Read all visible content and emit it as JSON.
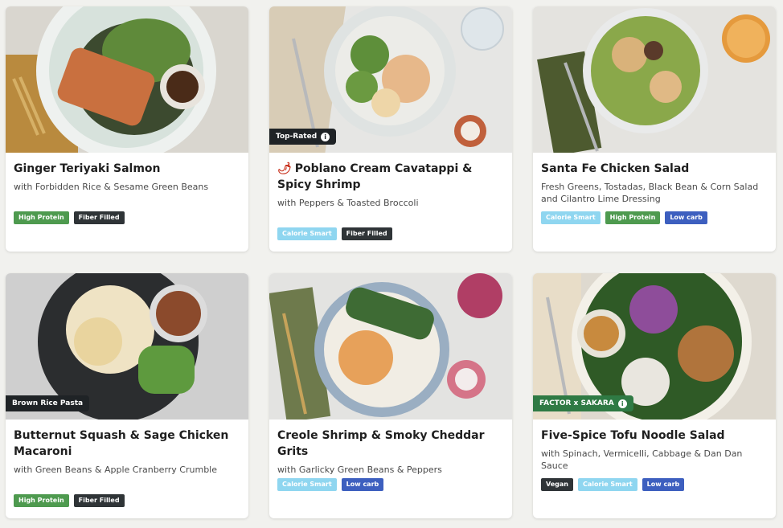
{
  "cards": [
    {
      "title": "Ginger Teriyaki Salmon",
      "subtitle": "with Forbidden Rice & Sesame Green Beans",
      "tags": [
        "High Protein",
        "Fiber Filled"
      ]
    },
    {
      "title": "Poblano Cream Cavatappi & Spicy Shrimp",
      "subtitle": "with Peppers & Toasted Broccoli",
      "badge": "Top-Rated",
      "spicy_icon": "chili-icon",
      "tags": [
        "Calorie Smart",
        "Fiber Filled"
      ]
    },
    {
      "title": "Santa Fe Chicken Salad",
      "subtitle": "Fresh Greens, Tostadas, Black Bean & Corn Salad and Cilantro Lime Dressing",
      "tags": [
        "Calorie Smart",
        "High Protein",
        "Low carb"
      ]
    },
    {
      "title": "Butternut Squash & Sage Chicken Macaroni",
      "subtitle": "with Green Beans & Apple Cranberry Crumble",
      "badge": "Brown Rice Pasta",
      "tags": [
        "High Protein",
        "Fiber Filled"
      ]
    },
    {
      "title": "Creole Shrimp & Smoky Cheddar Grits",
      "subtitle": "with Garlicky Green Beans & Peppers",
      "tags": [
        "Calorie Smart",
        "Low carb"
      ]
    },
    {
      "title": "Five-Spice Tofu Noodle Salad",
      "subtitle": "with Spinach, Vermicelli, Cabbage & Dan Dan Sauce",
      "badge": "FACTOR x SAKARA",
      "tags": [
        "Vegan",
        "Calorie Smart",
        "Low carb"
      ]
    }
  ],
  "tag_colors": {
    "High Protein": "#4e9a4f",
    "Fiber Filled": "#2f3437",
    "Calorie Smart": "#8fd6f0",
    "Low carb": "#3d5fbf",
    "Vegan": "#2f3437"
  }
}
